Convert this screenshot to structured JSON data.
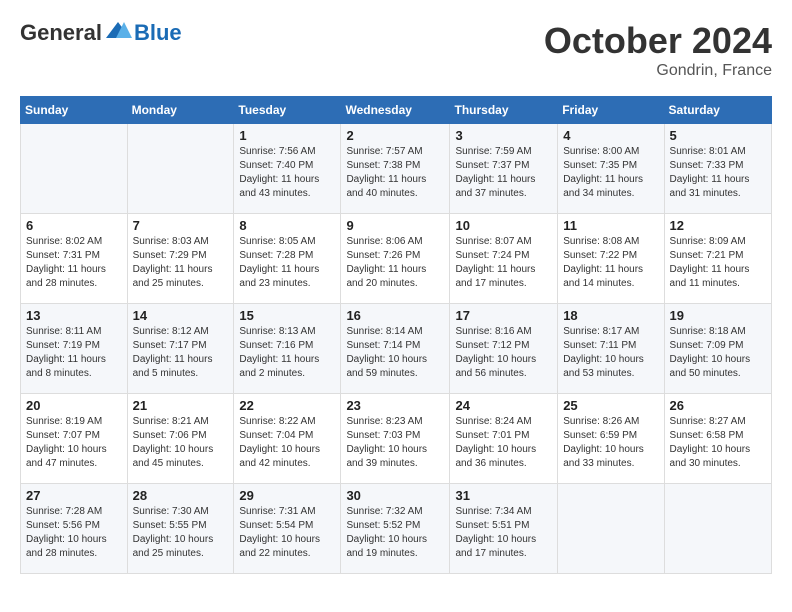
{
  "header": {
    "logo_general": "General",
    "logo_blue": "Blue",
    "month": "October 2024",
    "location": "Gondrin, France"
  },
  "days_of_week": [
    "Sunday",
    "Monday",
    "Tuesday",
    "Wednesday",
    "Thursday",
    "Friday",
    "Saturday"
  ],
  "weeks": [
    [
      {
        "day": "",
        "info": ""
      },
      {
        "day": "",
        "info": ""
      },
      {
        "day": "1",
        "info": "Sunrise: 7:56 AM\nSunset: 7:40 PM\nDaylight: 11 hours and 43 minutes."
      },
      {
        "day": "2",
        "info": "Sunrise: 7:57 AM\nSunset: 7:38 PM\nDaylight: 11 hours and 40 minutes."
      },
      {
        "day": "3",
        "info": "Sunrise: 7:59 AM\nSunset: 7:37 PM\nDaylight: 11 hours and 37 minutes."
      },
      {
        "day": "4",
        "info": "Sunrise: 8:00 AM\nSunset: 7:35 PM\nDaylight: 11 hours and 34 minutes."
      },
      {
        "day": "5",
        "info": "Sunrise: 8:01 AM\nSunset: 7:33 PM\nDaylight: 11 hours and 31 minutes."
      }
    ],
    [
      {
        "day": "6",
        "info": "Sunrise: 8:02 AM\nSunset: 7:31 PM\nDaylight: 11 hours and 28 minutes."
      },
      {
        "day": "7",
        "info": "Sunrise: 8:03 AM\nSunset: 7:29 PM\nDaylight: 11 hours and 25 minutes."
      },
      {
        "day": "8",
        "info": "Sunrise: 8:05 AM\nSunset: 7:28 PM\nDaylight: 11 hours and 23 minutes."
      },
      {
        "day": "9",
        "info": "Sunrise: 8:06 AM\nSunset: 7:26 PM\nDaylight: 11 hours and 20 minutes."
      },
      {
        "day": "10",
        "info": "Sunrise: 8:07 AM\nSunset: 7:24 PM\nDaylight: 11 hours and 17 minutes."
      },
      {
        "day": "11",
        "info": "Sunrise: 8:08 AM\nSunset: 7:22 PM\nDaylight: 11 hours and 14 minutes."
      },
      {
        "day": "12",
        "info": "Sunrise: 8:09 AM\nSunset: 7:21 PM\nDaylight: 11 hours and 11 minutes."
      }
    ],
    [
      {
        "day": "13",
        "info": "Sunrise: 8:11 AM\nSunset: 7:19 PM\nDaylight: 11 hours and 8 minutes."
      },
      {
        "day": "14",
        "info": "Sunrise: 8:12 AM\nSunset: 7:17 PM\nDaylight: 11 hours and 5 minutes."
      },
      {
        "day": "15",
        "info": "Sunrise: 8:13 AM\nSunset: 7:16 PM\nDaylight: 11 hours and 2 minutes."
      },
      {
        "day": "16",
        "info": "Sunrise: 8:14 AM\nSunset: 7:14 PM\nDaylight: 10 hours and 59 minutes."
      },
      {
        "day": "17",
        "info": "Sunrise: 8:16 AM\nSunset: 7:12 PM\nDaylight: 10 hours and 56 minutes."
      },
      {
        "day": "18",
        "info": "Sunrise: 8:17 AM\nSunset: 7:11 PM\nDaylight: 10 hours and 53 minutes."
      },
      {
        "day": "19",
        "info": "Sunrise: 8:18 AM\nSunset: 7:09 PM\nDaylight: 10 hours and 50 minutes."
      }
    ],
    [
      {
        "day": "20",
        "info": "Sunrise: 8:19 AM\nSunset: 7:07 PM\nDaylight: 10 hours and 47 minutes."
      },
      {
        "day": "21",
        "info": "Sunrise: 8:21 AM\nSunset: 7:06 PM\nDaylight: 10 hours and 45 minutes."
      },
      {
        "day": "22",
        "info": "Sunrise: 8:22 AM\nSunset: 7:04 PM\nDaylight: 10 hours and 42 minutes."
      },
      {
        "day": "23",
        "info": "Sunrise: 8:23 AM\nSunset: 7:03 PM\nDaylight: 10 hours and 39 minutes."
      },
      {
        "day": "24",
        "info": "Sunrise: 8:24 AM\nSunset: 7:01 PM\nDaylight: 10 hours and 36 minutes."
      },
      {
        "day": "25",
        "info": "Sunrise: 8:26 AM\nSunset: 6:59 PM\nDaylight: 10 hours and 33 minutes."
      },
      {
        "day": "26",
        "info": "Sunrise: 8:27 AM\nSunset: 6:58 PM\nDaylight: 10 hours and 30 minutes."
      }
    ],
    [
      {
        "day": "27",
        "info": "Sunrise: 7:28 AM\nSunset: 5:56 PM\nDaylight: 10 hours and 28 minutes."
      },
      {
        "day": "28",
        "info": "Sunrise: 7:30 AM\nSunset: 5:55 PM\nDaylight: 10 hours and 25 minutes."
      },
      {
        "day": "29",
        "info": "Sunrise: 7:31 AM\nSunset: 5:54 PM\nDaylight: 10 hours and 22 minutes."
      },
      {
        "day": "30",
        "info": "Sunrise: 7:32 AM\nSunset: 5:52 PM\nDaylight: 10 hours and 19 minutes."
      },
      {
        "day": "31",
        "info": "Sunrise: 7:34 AM\nSunset: 5:51 PM\nDaylight: 10 hours and 17 minutes."
      },
      {
        "day": "",
        "info": ""
      },
      {
        "day": "",
        "info": ""
      }
    ]
  ]
}
